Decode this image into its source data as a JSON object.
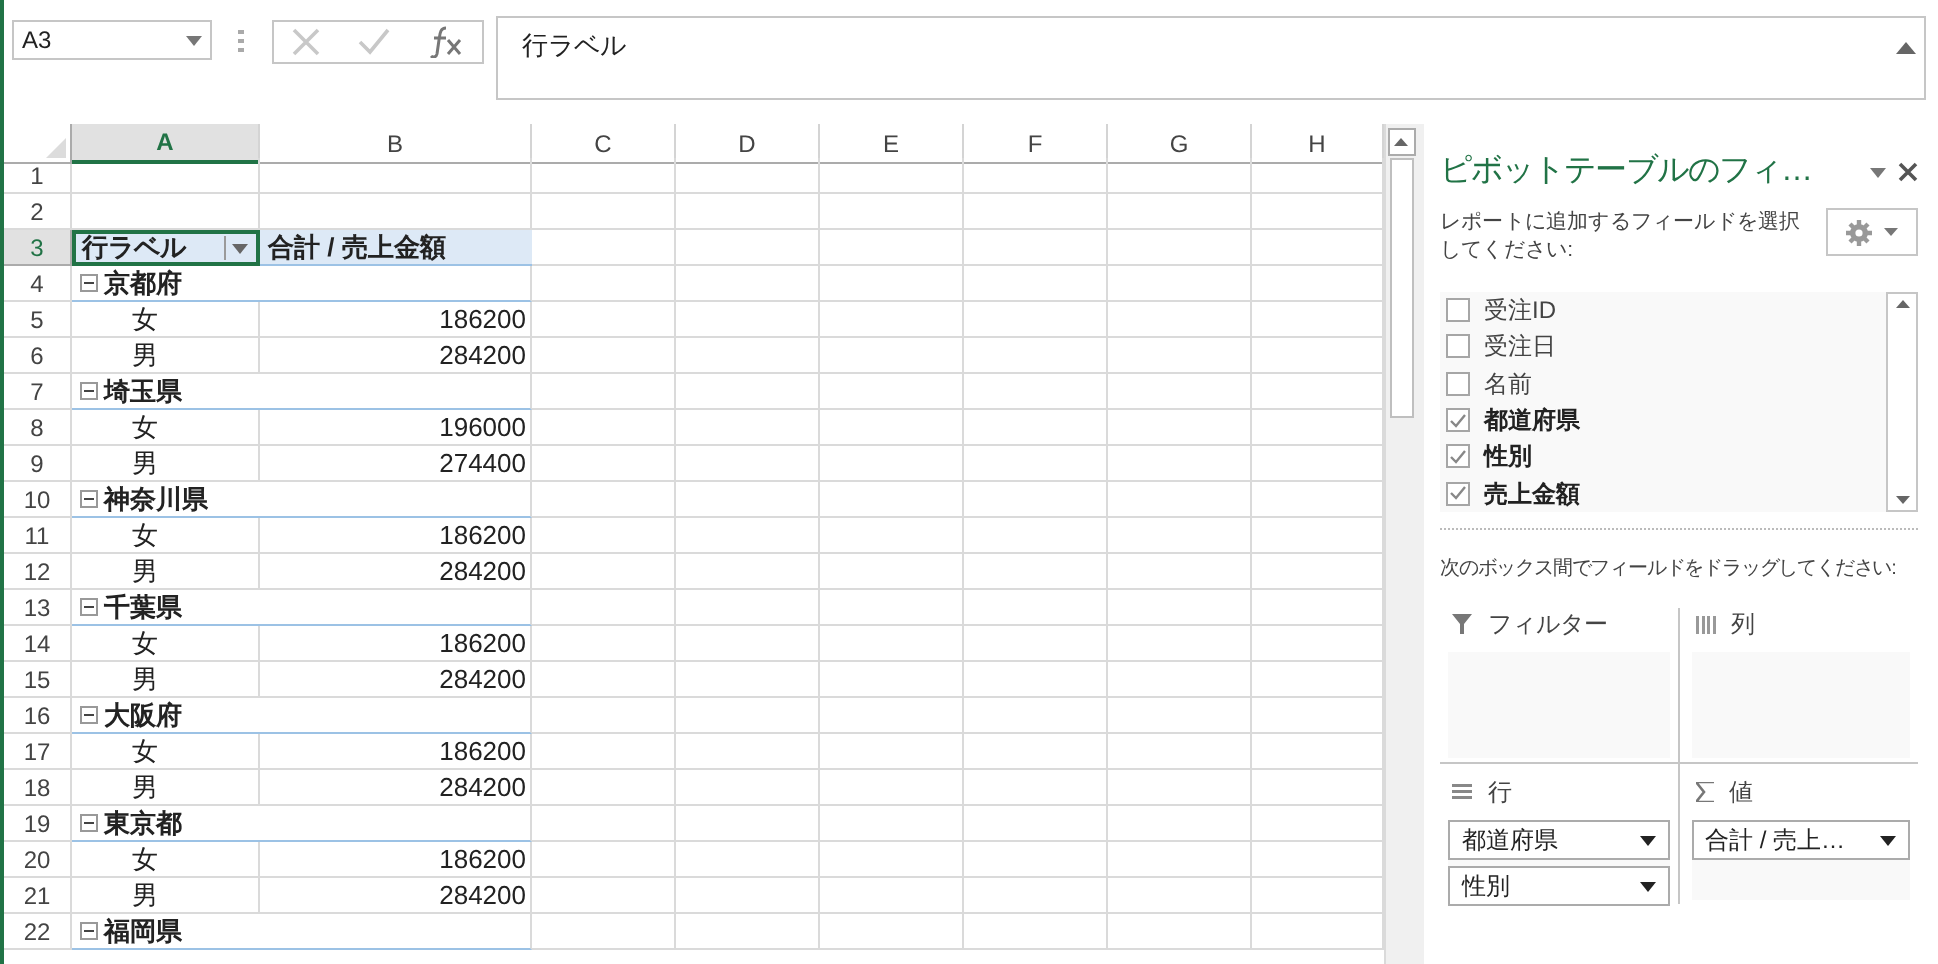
{
  "name_box": {
    "value": "A3"
  },
  "formula_bar": {
    "value": "行ラベル"
  },
  "columns": [
    {
      "label": "A",
      "selected": true
    },
    {
      "label": "B",
      "selected": false
    },
    {
      "label": "C",
      "selected": false
    },
    {
      "label": "D",
      "selected": false
    },
    {
      "label": "E",
      "selected": false
    },
    {
      "label": "F",
      "selected": false
    },
    {
      "label": "G",
      "selected": false
    },
    {
      "label": "H",
      "selected": false
    }
  ],
  "rows": [
    {
      "number": "1",
      "kind": "empty",
      "selected": false
    },
    {
      "number": "2",
      "kind": "empty",
      "selected": false
    },
    {
      "number": "3",
      "kind": "header",
      "selected": true,
      "label": "行ラベル",
      "value": "合計 / 売上金額"
    },
    {
      "number": "4",
      "kind": "group",
      "selected": false,
      "label": "京都府",
      "expanded": true
    },
    {
      "number": "5",
      "kind": "item",
      "selected": false,
      "label": "女",
      "value": "186200"
    },
    {
      "number": "6",
      "kind": "item",
      "selected": false,
      "label": "男",
      "value": "284200"
    },
    {
      "number": "7",
      "kind": "group",
      "selected": false,
      "label": "埼玉県",
      "expanded": true
    },
    {
      "number": "8",
      "kind": "item",
      "selected": false,
      "label": "女",
      "value": "196000"
    },
    {
      "number": "9",
      "kind": "item",
      "selected": false,
      "label": "男",
      "value": "274400"
    },
    {
      "number": "10",
      "kind": "group",
      "selected": false,
      "label": "神奈川県",
      "expanded": true
    },
    {
      "number": "11",
      "kind": "item",
      "selected": false,
      "label": "女",
      "value": "186200"
    },
    {
      "number": "12",
      "kind": "item",
      "selected": false,
      "label": "男",
      "value": "284200"
    },
    {
      "number": "13",
      "kind": "group",
      "selected": false,
      "label": "千葉県",
      "expanded": true
    },
    {
      "number": "14",
      "kind": "item",
      "selected": false,
      "label": "女",
      "value": "186200"
    },
    {
      "number": "15",
      "kind": "item",
      "selected": false,
      "label": "男",
      "value": "284200"
    },
    {
      "number": "16",
      "kind": "group",
      "selected": false,
      "label": "大阪府",
      "expanded": true
    },
    {
      "number": "17",
      "kind": "item",
      "selected": false,
      "label": "女",
      "value": "186200"
    },
    {
      "number": "18",
      "kind": "item",
      "selected": false,
      "label": "男",
      "value": "284200"
    },
    {
      "number": "19",
      "kind": "group",
      "selected": false,
      "label": "東京都",
      "expanded": true
    },
    {
      "number": "20",
      "kind": "item",
      "selected": false,
      "label": "女",
      "value": "186200"
    },
    {
      "number": "21",
      "kind": "item",
      "selected": false,
      "label": "男",
      "value": "284200"
    },
    {
      "number": "22",
      "kind": "group",
      "selected": false,
      "label": "福岡県",
      "expanded": true
    }
  ],
  "pane": {
    "title": "ピボットテーブルのフィ…",
    "instruction": "レポートに追加するフィールドを選択してください:",
    "fields": [
      {
        "label": "受注ID",
        "checked": false
      },
      {
        "label": "受注日",
        "checked": false
      },
      {
        "label": "名前",
        "checked": false
      },
      {
        "label": "都道府県",
        "checked": true
      },
      {
        "label": "性別",
        "checked": true
      },
      {
        "label": "売上金額",
        "checked": true
      }
    ],
    "drag_instruction": "次のボックス間でフィールドをドラッグしてください:",
    "areas": [
      {
        "kind": "filter",
        "label": "フィルター"
      },
      {
        "kind": "columns",
        "label": "列"
      },
      {
        "kind": "rows",
        "label": "行",
        "fields": [
          "都道府県",
          "性別"
        ]
      },
      {
        "kind": "values",
        "label": "値",
        "fields": [
          "合計 / 売上…"
        ]
      }
    ]
  }
}
